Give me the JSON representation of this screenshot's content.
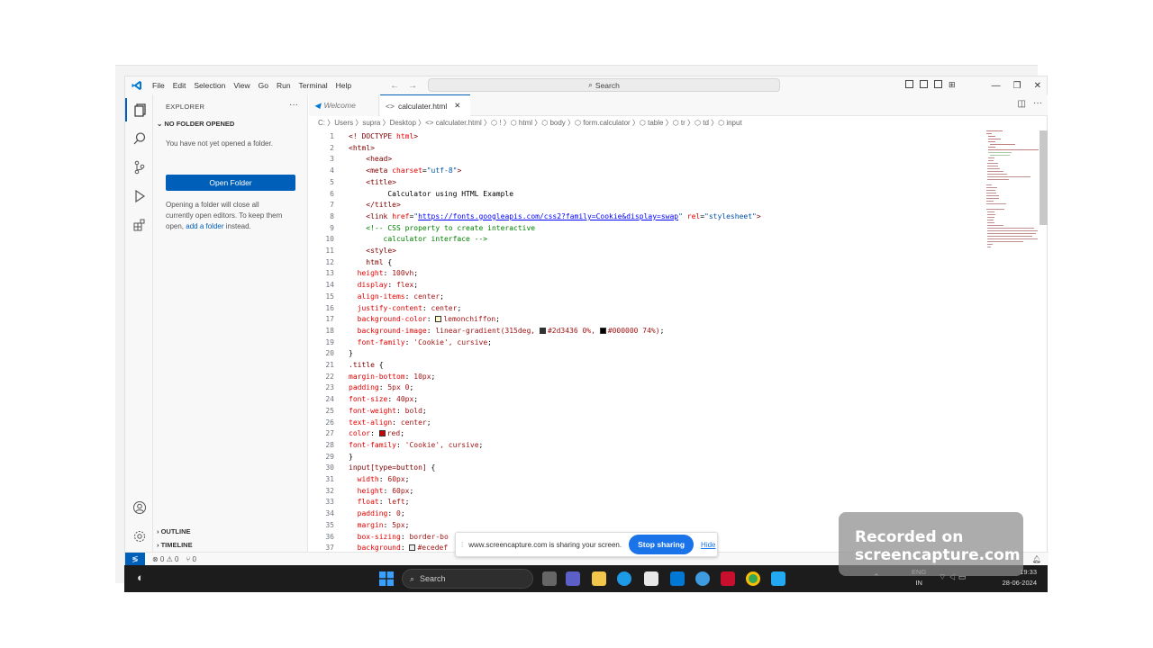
{
  "menu": [
    "File",
    "Edit",
    "Selection",
    "View",
    "Go",
    "Run",
    "Terminal",
    "Help"
  ],
  "search_label": "Search",
  "sidebar": {
    "title": "EXPLORER",
    "more": "···",
    "section": "NO FOLDER OPENED",
    "not_opened": "You have not yet opened a folder.",
    "open_button": "Open Folder",
    "info_line1": "Opening a folder will close all",
    "info_line2": "currently open editors. To keep them",
    "info_prefix": "open, ",
    "info_link": "add a folder",
    "info_suffix": " instead.",
    "outline": "OUTLINE",
    "timeline": "TIMELINE"
  },
  "tabs": {
    "welcome": "Welcome",
    "file": "calculater.html"
  },
  "breadcrumb": "C: 〉Users 〉supra 〉Desktop 〉<> calculater.html 〉⬡ ! 〉⬡ html 〉⬡ body 〉⬡ form.calculator 〉⬡ table 〉⬡ tr 〉⬡ td 〉⬡ input",
  "status": {
    "problems": "⊗ 0 ⚠ 0",
    "ports": "⑂ 0"
  },
  "share": {
    "message": "www.screencapture.com is sharing your screen.",
    "stop": "Stop sharing",
    "hide": "Hide"
  },
  "taskbar": {
    "search": "Search",
    "lang1": "ENG",
    "lang2": "IN",
    "time": "19:33",
    "date": "28-06-2024"
  },
  "watermark": {
    "line1": "Recorded on",
    "line2": "screencapture.com"
  },
  "colors": {
    "accent": "#005fb8",
    "lemonchiffon": "#fffacd",
    "swatch1": "#2d3436",
    "swatch2": "#000000",
    "red": "#cc0000"
  }
}
